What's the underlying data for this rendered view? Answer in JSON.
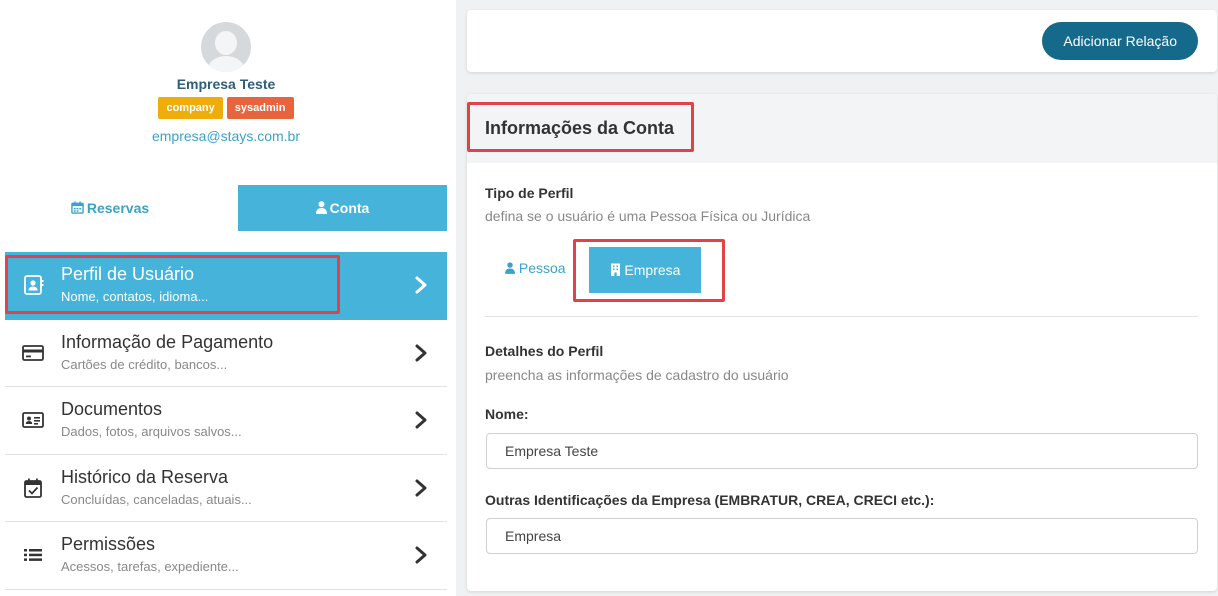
{
  "profile": {
    "name": "Empresa Teste",
    "badges": [
      "company",
      "sysadmin"
    ],
    "email": "empresa@stays.com.br"
  },
  "tabs": {
    "reservas": "Reservas",
    "conta": "Conta"
  },
  "menu": [
    {
      "title": "Perfil de Usuário",
      "subtitle": "Nome, contatos, idioma...",
      "icon": "user-card-icon",
      "active": true
    },
    {
      "title": "Informação de Pagamento",
      "subtitle": "Cartões de crédito, bancos...",
      "icon": "credit-card-icon",
      "active": false
    },
    {
      "title": "Documentos",
      "subtitle": "Dados, fotos, arquivos salvos...",
      "icon": "id-card-icon",
      "active": false
    },
    {
      "title": "Histórico da Reserva",
      "subtitle": "Concluídas, canceladas, atuais...",
      "icon": "calendar-check-icon",
      "active": false
    },
    {
      "title": "Permissões",
      "subtitle": "Acessos, tarefas, expediente...",
      "icon": "list-icon",
      "active": false
    }
  ],
  "topbar": {
    "add_relation": "Adicionar Relação"
  },
  "account": {
    "title": "Informações da Conta",
    "profile_type_label": "Tipo de Perfil",
    "profile_type_help": "defina se o usuário é uma Pessoa Física ou Jurídica",
    "option_pessoa": "Pessoa",
    "option_empresa": "Empresa",
    "selected_type": "Empresa",
    "details_label": "Detalhes do Perfil",
    "details_help": "preencha as informações de cadastro do usuário",
    "name_label": "Nome:",
    "name_value": "Empresa Teste",
    "other_ids_label": "Outras Identificações da Empresa (EMBRATUR, CREA, CRECI etc.):",
    "other_ids_value": "Empresa"
  },
  "colors": {
    "accent": "#45b3da",
    "dark_button": "#156a8b",
    "badge_company": "#f0ad0a",
    "badge_sysadmin": "#e8643c",
    "highlight": "#e0424a"
  }
}
